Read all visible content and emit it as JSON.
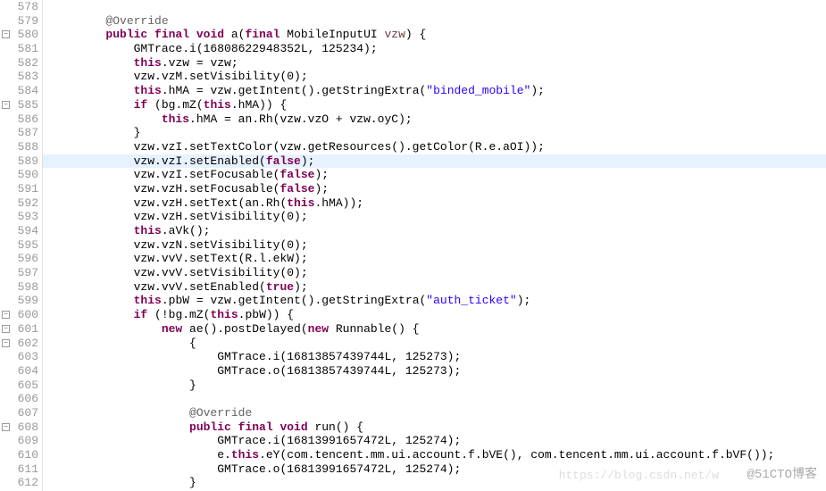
{
  "lines": [
    {
      "num": "578",
      "fold": "",
      "cls": "",
      "code": "",
      "tokens": []
    },
    {
      "num": "579",
      "fold": "",
      "cls": "",
      "code": "        ",
      "tokens": [
        {
          "t": "@Override",
          "c": "ann"
        }
      ]
    },
    {
      "num": "580",
      "fold": "-",
      "cls": "",
      "code": "        ",
      "tokens": [
        {
          "t": "public final void",
          "c": "kw"
        },
        {
          "t": " a(",
          "c": ""
        },
        {
          "t": "final",
          "c": "kw"
        },
        {
          "t": " MobileInputUI ",
          "c": ""
        },
        {
          "t": "vzw",
          "c": "param"
        },
        {
          "t": ") {",
          "c": ""
        }
      ]
    },
    {
      "num": "581",
      "fold": "",
      "cls": "",
      "code": "            GMTrace.i(16808622948352L, 125234);",
      "tokens": []
    },
    {
      "num": "582",
      "fold": "",
      "cls": "",
      "code": "            ",
      "tokens": [
        {
          "t": "this",
          "c": "kw"
        },
        {
          "t": ".vzw = vzw;",
          "c": ""
        }
      ]
    },
    {
      "num": "583",
      "fold": "",
      "cls": "",
      "code": "            vzw.vzM.setVisibility(0);",
      "tokens": []
    },
    {
      "num": "584",
      "fold": "",
      "cls": "",
      "code": "            ",
      "tokens": [
        {
          "t": "this",
          "c": "kw"
        },
        {
          "t": ".hMA = vzw.getIntent().getStringExtra(",
          "c": ""
        },
        {
          "t": "\"binded_mobile\"",
          "c": "str"
        },
        {
          "t": ");",
          "c": ""
        }
      ]
    },
    {
      "num": "585",
      "fold": "-",
      "cls": "",
      "code": "            ",
      "tokens": [
        {
          "t": "if",
          "c": "kw"
        },
        {
          "t": " (bg.mZ(",
          "c": ""
        },
        {
          "t": "this",
          "c": "kw"
        },
        {
          "t": ".hMA)) {",
          "c": ""
        }
      ]
    },
    {
      "num": "586",
      "fold": "",
      "cls": "",
      "code": "                ",
      "tokens": [
        {
          "t": "this",
          "c": "kw"
        },
        {
          "t": ".hMA = an.Rh(vzw.vzO + vzw.oyC);",
          "c": ""
        }
      ]
    },
    {
      "num": "587",
      "fold": "",
      "cls": "",
      "code": "            }",
      "tokens": []
    },
    {
      "num": "588",
      "fold": "",
      "cls": "",
      "code": "            vzw.vzI.setTextColor(vzw.getResources().getColor(R.e.aOI));",
      "tokens": []
    },
    {
      "num": "589",
      "fold": "",
      "cls": "hl",
      "code": "            vzw.vzI.setEnabled(",
      "tokens": [
        {
          "t": "false",
          "c": "kw"
        },
        {
          "t": ");",
          "c": ""
        }
      ]
    },
    {
      "num": "590",
      "fold": "",
      "cls": "",
      "code": "            vzw.vzI.setFocusable(",
      "tokens": [
        {
          "t": "false",
          "c": "kw"
        },
        {
          "t": ");",
          "c": ""
        }
      ]
    },
    {
      "num": "591",
      "fold": "",
      "cls": "",
      "code": "            vzw.vzH.setFocusable(",
      "tokens": [
        {
          "t": "false",
          "c": "kw"
        },
        {
          "t": ");",
          "c": ""
        }
      ]
    },
    {
      "num": "592",
      "fold": "",
      "cls": "",
      "code": "            vzw.vzH.setText(an.Rh(",
      "tokens": [
        {
          "t": "this",
          "c": "kw"
        },
        {
          "t": ".hMA));",
          "c": ""
        }
      ]
    },
    {
      "num": "593",
      "fold": "",
      "cls": "",
      "code": "            vzw.vzH.setVisibility(0);",
      "tokens": []
    },
    {
      "num": "594",
      "fold": "",
      "cls": "",
      "code": "            ",
      "tokens": [
        {
          "t": "this",
          "c": "kw"
        },
        {
          "t": ".aVk();",
          "c": ""
        }
      ]
    },
    {
      "num": "595",
      "fold": "",
      "cls": "",
      "code": "            vzw.vzN.setVisibility(0);",
      "tokens": []
    },
    {
      "num": "596",
      "fold": "",
      "cls": "",
      "code": "            vzw.vvV.setText(R.l.ekW);",
      "tokens": []
    },
    {
      "num": "597",
      "fold": "",
      "cls": "",
      "code": "            vzw.vvV.setVisibility(0);",
      "tokens": []
    },
    {
      "num": "598",
      "fold": "",
      "cls": "",
      "code": "            vzw.vvV.setEnabled(",
      "tokens": [
        {
          "t": "true",
          "c": "kw"
        },
        {
          "t": ");",
          "c": ""
        }
      ]
    },
    {
      "num": "599",
      "fold": "",
      "cls": "",
      "code": "            ",
      "tokens": [
        {
          "t": "this",
          "c": "kw"
        },
        {
          "t": ".pbW = vzw.getIntent().getStringExtra(",
          "c": ""
        },
        {
          "t": "\"auth_ticket\"",
          "c": "str"
        },
        {
          "t": ");",
          "c": ""
        }
      ]
    },
    {
      "num": "600",
      "fold": "-",
      "cls": "",
      "code": "            ",
      "tokens": [
        {
          "t": "if",
          "c": "kw"
        },
        {
          "t": " (!bg.mZ(",
          "c": ""
        },
        {
          "t": "this",
          "c": "kw"
        },
        {
          "t": ".pbW)) {",
          "c": ""
        }
      ]
    },
    {
      "num": "601",
      "fold": "-",
      "cls": "",
      "code": "                ",
      "tokens": [
        {
          "t": "new",
          "c": "kw"
        },
        {
          "t": " ae().postDelayed(",
          "c": ""
        },
        {
          "t": "new",
          "c": "kw"
        },
        {
          "t": " Runnable() {",
          "c": ""
        }
      ]
    },
    {
      "num": "602",
      "fold": "-",
      "cls": "",
      "code": "                    {",
      "tokens": []
    },
    {
      "num": "603",
      "fold": "",
      "cls": "",
      "code": "                        GMTrace.i(16813857439744L, 125273);",
      "tokens": []
    },
    {
      "num": "604",
      "fold": "",
      "cls": "",
      "code": "                        GMTrace.o(16813857439744L, 125273);",
      "tokens": []
    },
    {
      "num": "605",
      "fold": "",
      "cls": "",
      "code": "                    }",
      "tokens": []
    },
    {
      "num": "606",
      "fold": "",
      "cls": "",
      "code": "",
      "tokens": []
    },
    {
      "num": "607",
      "fold": "",
      "cls": "",
      "code": "                    ",
      "tokens": [
        {
          "t": "@Override",
          "c": "ann"
        }
      ]
    },
    {
      "num": "608",
      "fold": "-",
      "cls": "",
      "code": "                    ",
      "tokens": [
        {
          "t": "public final void",
          "c": "kw"
        },
        {
          "t": " run() {",
          "c": ""
        }
      ]
    },
    {
      "num": "609",
      "fold": "",
      "cls": "",
      "code": "                        GMTrace.i(16813991657472L, 125274);",
      "tokens": []
    },
    {
      "num": "610",
      "fold": "",
      "cls": "",
      "code": "                        e.",
      "tokens": [
        {
          "t": "this",
          "c": "kw"
        },
        {
          "t": ".eY(com.tencent.mm.ui.account.f.bVE(), com.tencent.mm.ui.account.f.bVF());",
          "c": ""
        }
      ]
    },
    {
      "num": "611",
      "fold": "",
      "cls": "",
      "code": "                        GMTrace.o(16813991657472L, 125274);",
      "tokens": []
    },
    {
      "num": "612",
      "fold": "",
      "cls": "",
      "code": "                    }",
      "tokens": []
    }
  ],
  "watermark": "@51CTO博客",
  "wm2": "https://blog.csdn.net/w"
}
